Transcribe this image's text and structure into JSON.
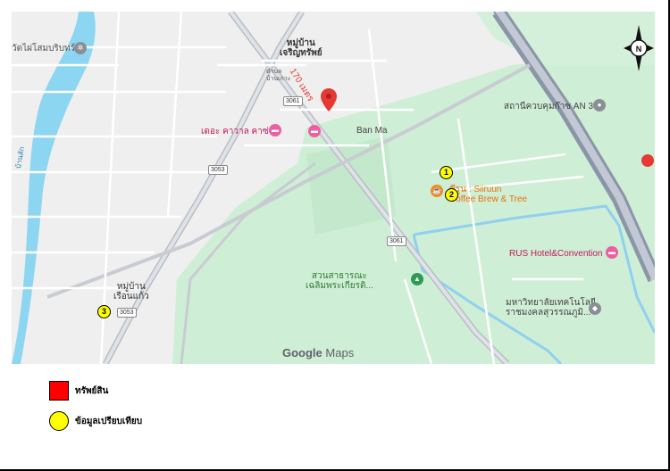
{
  "map": {
    "labels": {
      "temple": "วัดไผ่โสมบริบทร์",
      "village_top": "หมู่บ้าน\nเจริญทรัพย์",
      "village_top_small": "ตำบล\nบ้านเกาะ",
      "distance": "170 เมตร",
      "ban_ma": "Ban Ma",
      "hotel_pink": "เดอะ คาวาล คาซ่า",
      "station": "สถานีควบคุมก๊าซ AN 3",
      "cafe": "ซีรูน : Siiruun\nCoffee Brew & Tree",
      "rus_hotel": "RUS Hotel&Convention",
      "park": "สวนสาธารณะ\nเฉลิมพระเกียรติ...",
      "university": "มหาวิทยาลัยเทคโนโลยี\nราชมงคลสุวรรณภูมิ...",
      "village_bottom": "หมู่บ้าน\nเรือนแก้ว",
      "river": "บ้านลัก",
      "road_3061_top": "3061",
      "road_3053_mid": "3053",
      "road_3061_mid": "3061",
      "road_3053_bottom": "3053",
      "google_brand": "Google",
      "google_maps": "Maps",
      "compass_n": "N"
    },
    "markers": {
      "m1": "1",
      "m2": "2",
      "m3": "3"
    },
    "colors": {
      "subject_marker": "#e53935",
      "comparable_marker": "#ffff00",
      "river": "#7dd3f0",
      "green": "#c8ebd0"
    }
  },
  "legend": {
    "property_label": "ทรัพย์สิน",
    "comparable_label": "ข้อมูลเปรียบเทียบ",
    "property_color": "#ff0000",
    "comparable_color": "#ffff00"
  }
}
